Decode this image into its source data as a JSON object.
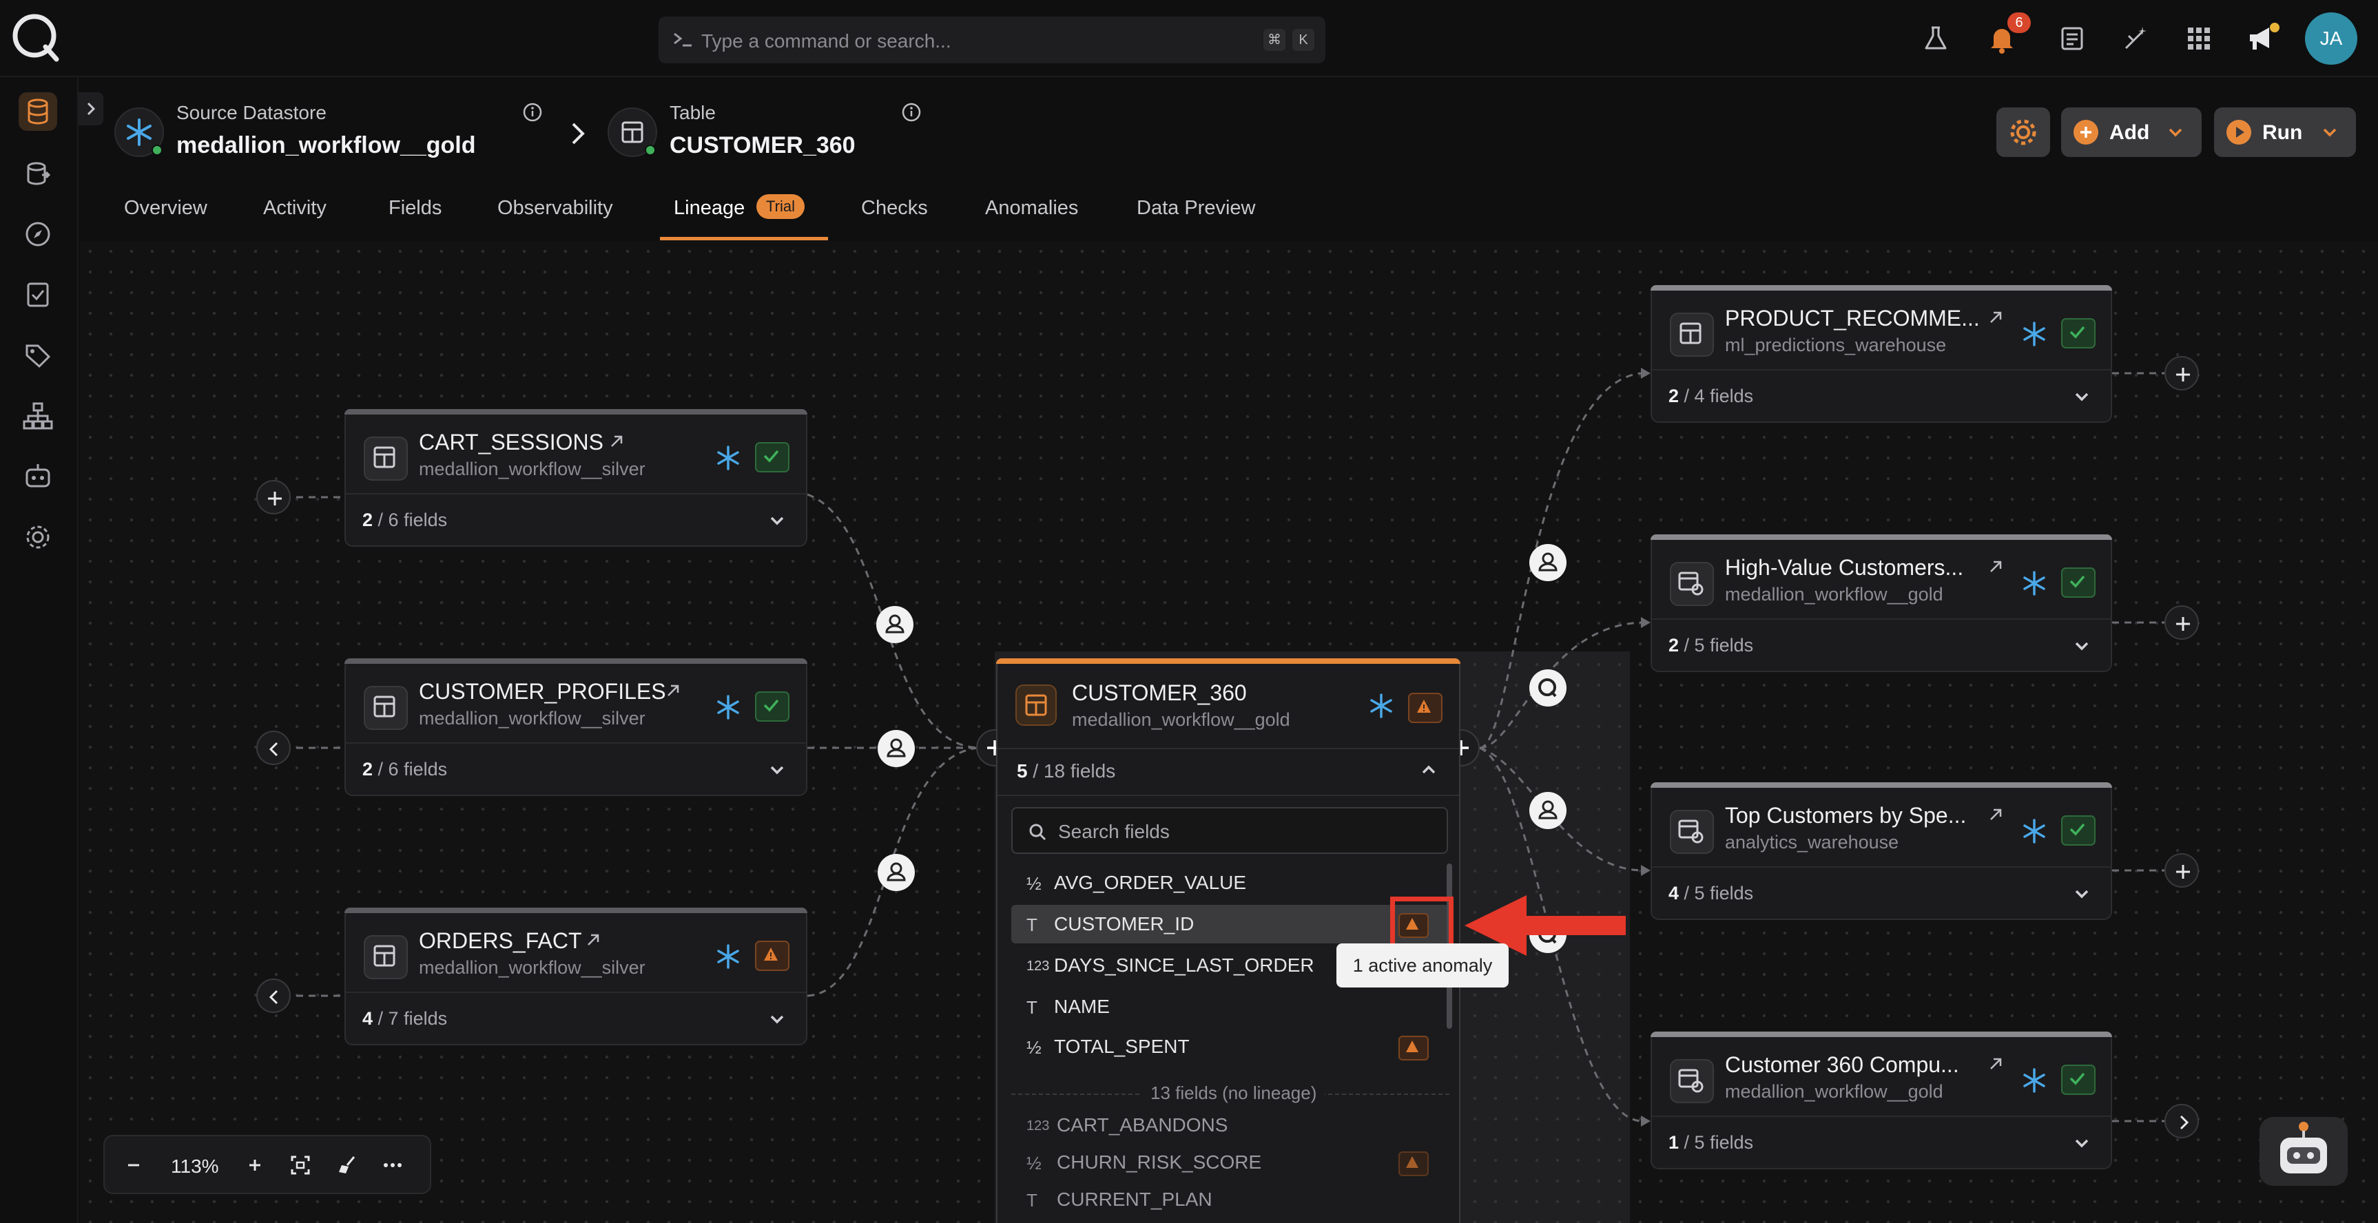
{
  "command_bar": {
    "placeholder": "Type a command or search...",
    "shortcut_mod": "⌘",
    "shortcut_key": "K"
  },
  "notifications": {
    "count": "6"
  },
  "user": {
    "initials": "JA"
  },
  "header": {
    "datastore_label": "Source Datastore",
    "datastore_name": "medallion_workflow__gold",
    "table_label": "Table",
    "table_name": "CUSTOMER_360"
  },
  "tabs": [
    {
      "label": "Overview"
    },
    {
      "label": "Activity"
    },
    {
      "label": "Fields"
    },
    {
      "label": "Observability"
    },
    {
      "label": "Lineage",
      "badge": "Trial",
      "active": true
    },
    {
      "label": "Checks"
    },
    {
      "label": "Anomalies"
    },
    {
      "label": "Data Preview"
    }
  ],
  "buttons": {
    "add": "Add",
    "run": "Run"
  },
  "upstream_nodes": [
    {
      "title": "CART_SESSIONS",
      "subtitle": "medallion_workflow__silver",
      "fields_shown": "2",
      "fields_total": "/ 6 fields",
      "status": "ok"
    },
    {
      "title": "CUSTOMER_PROFILES",
      "subtitle": "medallion_workflow__silver",
      "fields_shown": "2",
      "fields_total": "/ 6 fields",
      "status": "ok"
    },
    {
      "title": "ORDERS_FACT",
      "subtitle": "medallion_workflow__silver",
      "fields_shown": "4",
      "fields_total": "/ 7 fields",
      "status": "warn"
    }
  ],
  "center_node": {
    "title": "CUSTOMER_360",
    "subtitle": "medallion_workflow__gold",
    "fields_shown": "5",
    "fields_total": "/ 18 fields",
    "search_placeholder": "Search fields",
    "fields": [
      {
        "type": "½",
        "name": "AVG_ORDER_VALUE",
        "anomaly": false
      },
      {
        "type": "T",
        "name": "CUSTOMER_ID",
        "anomaly": true,
        "highlight": true
      },
      {
        "type": "123",
        "name": "DAYS_SINCE_LAST_ORDER",
        "anomaly": false
      },
      {
        "type": "T",
        "name": "NAME",
        "anomaly": false
      },
      {
        "type": "½",
        "name": "TOTAL_SPENT",
        "anomaly": true
      }
    ],
    "no_lineage_label": "13 fields (no lineage)",
    "other_fields": [
      {
        "type": "123",
        "name": "CART_ABANDONS",
        "anomaly": false
      },
      {
        "type": "½",
        "name": "CHURN_RISK_SCORE",
        "anomaly": true
      },
      {
        "type": "T",
        "name": "CURRENT_PLAN",
        "anomaly": false
      }
    ],
    "tooltip": "1 active anomaly"
  },
  "downstream_nodes": [
    {
      "title": "PRODUCT_RECOMME...",
      "subtitle": "ml_predictions_warehouse",
      "fields_shown": "2",
      "fields_total": "/ 4 fields",
      "status": "ok"
    },
    {
      "title": "High-Value Customers...",
      "subtitle": "medallion_workflow__gold",
      "fields_shown": "2",
      "fields_total": "/ 5 fields",
      "status": "ok"
    },
    {
      "title": "Top Customers by Spe...",
      "subtitle": "analytics_warehouse",
      "fields_shown": "4",
      "fields_total": "/ 5 fields",
      "status": "ok"
    },
    {
      "title": "Customer 360 Compu...",
      "subtitle": "medallion_workflow__gold",
      "fields_shown": "1",
      "fields_total": "/ 5 fields",
      "status": "ok"
    }
  ],
  "zoom": {
    "level": "113%"
  },
  "colors": {
    "accent": "#e8893a",
    "ok": "#3fb15a",
    "warn": "#e07a2e",
    "annotation": "#e5372a",
    "snowflake": "#4aa8e8"
  }
}
